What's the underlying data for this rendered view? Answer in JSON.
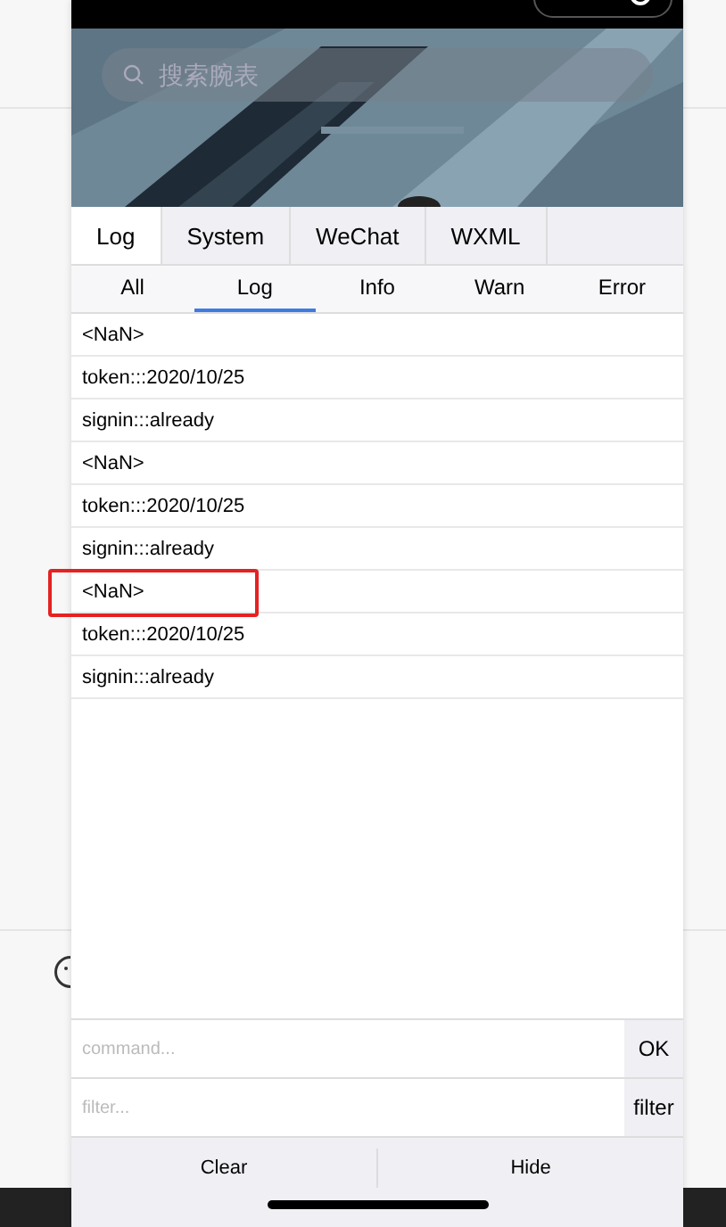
{
  "search": {
    "placeholder": "搜索腕表"
  },
  "tabs": [
    {
      "label": "Log",
      "selected": true
    },
    {
      "label": "System",
      "selected": false
    },
    {
      "label": "WeChat",
      "selected": false
    },
    {
      "label": "WXML",
      "selected": false
    }
  ],
  "filters": [
    {
      "label": "All",
      "selected": false
    },
    {
      "label": "Log",
      "selected": true
    },
    {
      "label": "Info",
      "selected": false
    },
    {
      "label": "Warn",
      "selected": false
    },
    {
      "label": "Error",
      "selected": false
    }
  ],
  "log_rows": [
    {
      "text": "<NaN>",
      "highlighted": false
    },
    {
      "text": "token:::2020/10/25",
      "highlighted": false
    },
    {
      "text": "signin:::already",
      "highlighted": false
    },
    {
      "text": "<NaN>",
      "highlighted": false
    },
    {
      "text": "token:::2020/10/25",
      "highlighted": false
    },
    {
      "text": "signin:::already",
      "highlighted": false
    },
    {
      "text": "<NaN>",
      "highlighted": true
    },
    {
      "text": "token:::2020/10/25",
      "highlighted": false
    },
    {
      "text": "signin:::already",
      "highlighted": false
    }
  ],
  "command": {
    "placeholder": "command...",
    "button": "OK"
  },
  "filter": {
    "placeholder": "filter...",
    "button": "filter"
  },
  "footer_buttons": [
    "Clear",
    "Hide"
  ]
}
